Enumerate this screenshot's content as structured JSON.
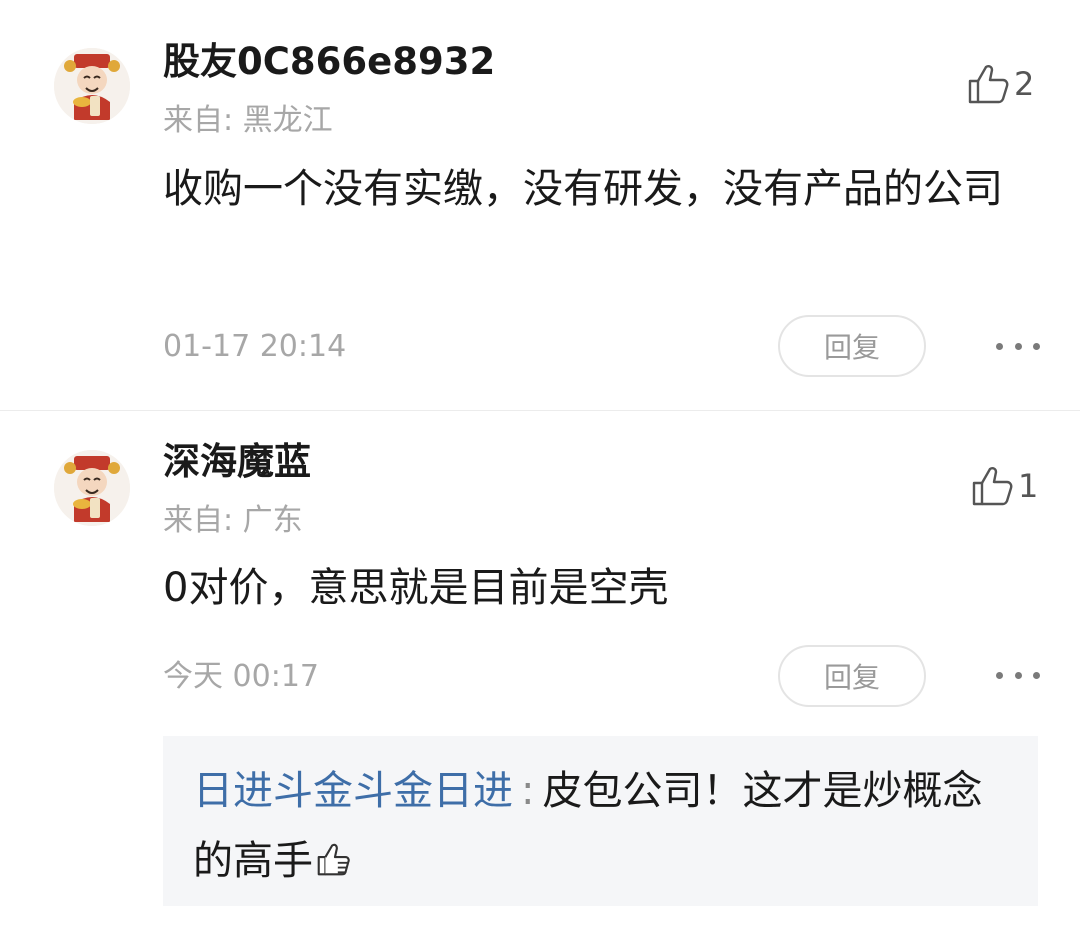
{
  "comments": [
    {
      "username": "股友0C866e8932",
      "origin": "来自: 黑龙江",
      "content": "收购一个没有实缴，没有研发，没有产品的公司",
      "time": "01-17 20:14",
      "likes": "2",
      "reply_label": "回复"
    },
    {
      "username": "深海魔蓝",
      "origin": "来自: 广东",
      "content": "0对价，意思就是目前是空壳",
      "time": "今天 00:17",
      "likes": "1",
      "reply_label": "回复",
      "sub_reply": {
        "author": "日进斗金斗金日进",
        "separator": ":",
        "text": "皮包公司！这才是炒概念的高手"
      }
    }
  ],
  "colors": {
    "username": "#1a1a1a",
    "meta": "#a7a7a7",
    "sub_author": "#3e6ea8",
    "sub_reply_bg": "#f5f6f8"
  },
  "icons": {
    "like": "thumb-up-icon",
    "more": "more-dots-icon",
    "avatar": "cartoon-god-of-wealth-avatar",
    "inline_emoji": "thumb-up-emoji-icon"
  }
}
